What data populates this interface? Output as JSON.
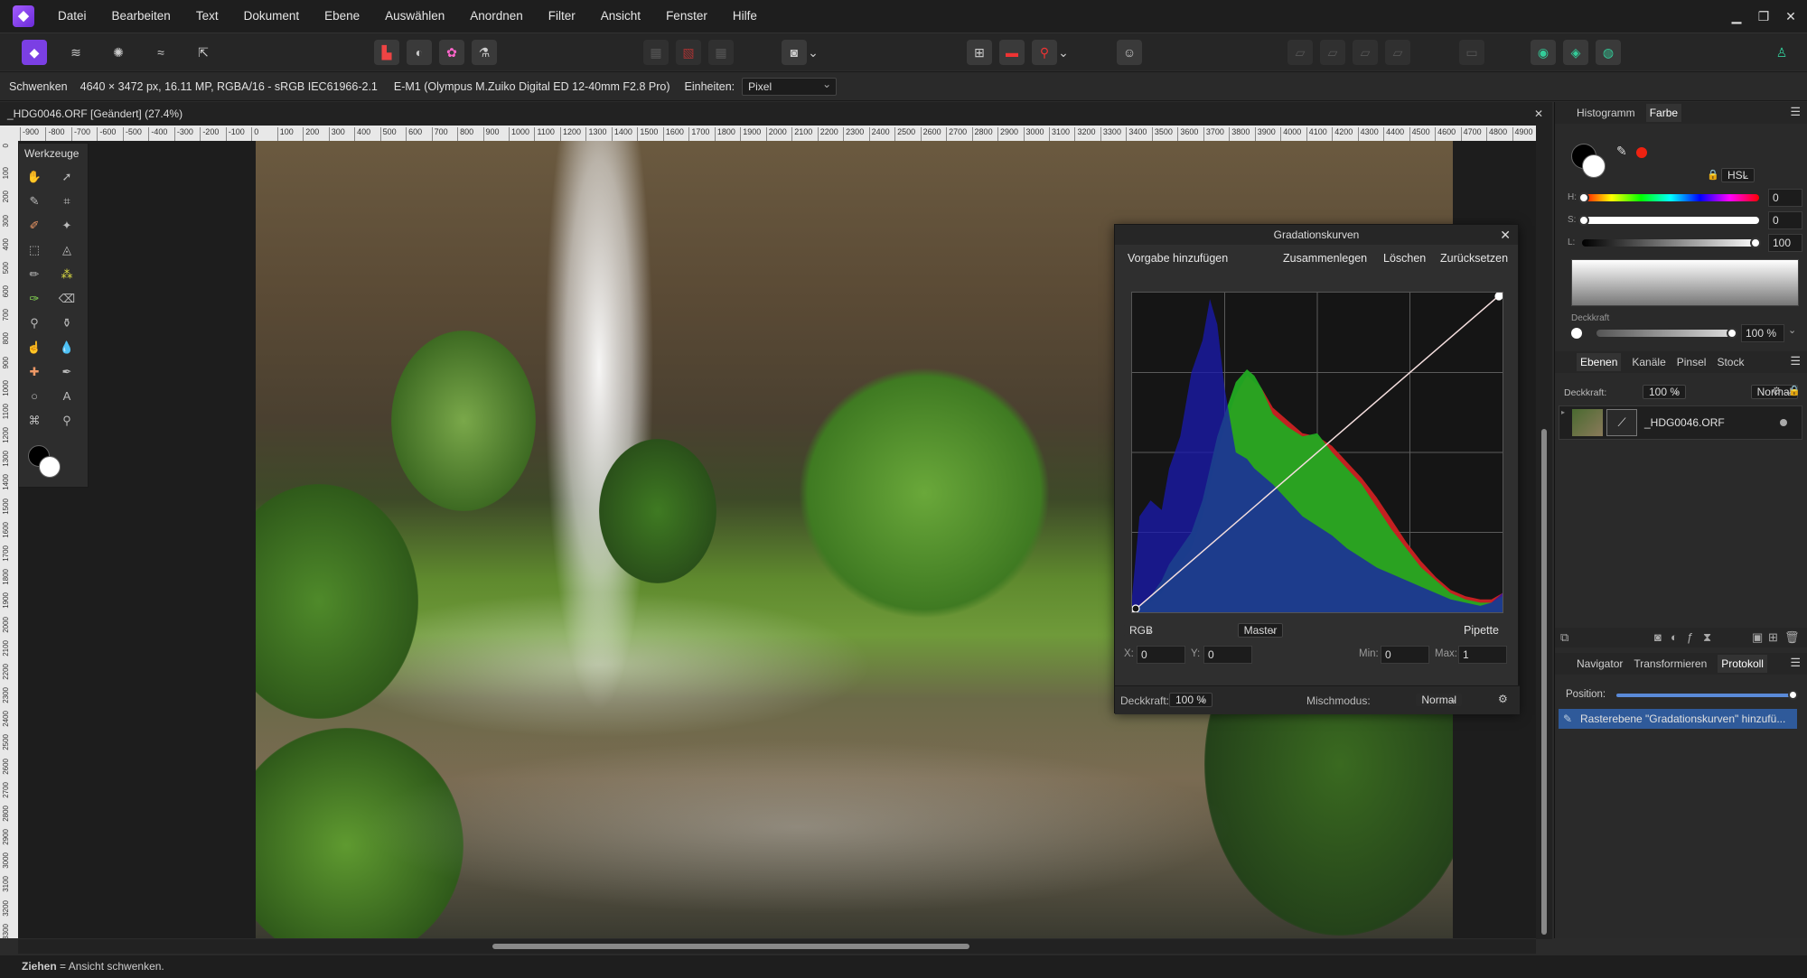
{
  "menubar": {
    "items": [
      "Datei",
      "Bearbeiten",
      "Text",
      "Dokument",
      "Ebene",
      "Auswählen",
      "Anordnen",
      "Filter",
      "Ansicht",
      "Fenster",
      "Hilfe"
    ]
  },
  "contextbar": {
    "tool": "Schwenken",
    "image_info": "4640 × 3472 px, 16.11 MP, RGBA/16 - sRGB IEC61966-2.1",
    "camera": "E-M1 (Olympus M.Zuiko Digital ED 12-40mm F2.8 Pro)",
    "units_label": "Einheiten:",
    "units_value": "Pixel"
  },
  "document": {
    "tab_title": "_HDG0046.ORF [Geändert] (27.4%)"
  },
  "ruler": {
    "h_labels": [
      "-900",
      "-800",
      "-700",
      "-600",
      "-500",
      "-400",
      "-300",
      "-200",
      "-100",
      "0",
      "100",
      "200",
      "300",
      "400",
      "500",
      "600",
      "700",
      "800",
      "900",
      "1000",
      "1100",
      "1200",
      "1300",
      "1400",
      "1500",
      "1600",
      "1700",
      "1800",
      "1900",
      "2000",
      "2100",
      "2200",
      "2300",
      "2400",
      "2500",
      "2600",
      "2700",
      "2800",
      "2900",
      "3000",
      "3100",
      "3200",
      "3300",
      "3400",
      "3500",
      "3600",
      "3700",
      "3800",
      "3900",
      "4000",
      "4100",
      "4200",
      "4300",
      "4400",
      "4500",
      "4600",
      "4700",
      "4800",
      "4900"
    ],
    "v_labels": [
      "0",
      "100",
      "200",
      "300",
      "400",
      "500",
      "600",
      "700",
      "800",
      "900",
      "1000",
      "1100",
      "1200",
      "1300",
      "1400",
      "1500",
      "1600",
      "1700",
      "1800",
      "1900",
      "2000",
      "2100",
      "2200",
      "2300",
      "2400",
      "2500",
      "2600",
      "2700",
      "2800",
      "2900",
      "3000",
      "3100",
      "3200",
      "3300"
    ]
  },
  "tools": {
    "title": "Werkzeuge"
  },
  "curves": {
    "title": "Gradationskurven",
    "add_preset": "Vorgabe hinzufügen",
    "merge": "Zusammenlegen",
    "delete": "Löschen",
    "reset": "Zurücksetzen",
    "channel": "RGB",
    "mode": "Master",
    "picker": "Pipette",
    "x_label": "X:",
    "x_value": "0",
    "y_label": "Y:",
    "y_value": "0",
    "min_label": "Min:",
    "min_value": "0",
    "max_label": "Max:",
    "max_value": "1",
    "opacity_label": "Deckkraft:",
    "opacity_value": "100 %",
    "blend_label": "Mischmodus:",
    "blend_value": "Normal"
  },
  "color_panel": {
    "tab_histogram": "Histogramm",
    "tab_color": "Farbe",
    "model": "HSL",
    "h_label": "H:",
    "h_value": "0",
    "s_label": "S:",
    "s_value": "0",
    "l_label": "L:",
    "l_value": "100",
    "opacity_label": "Deckkraft",
    "opacity_value": "100 %"
  },
  "layers_panel": {
    "tabs": [
      "Ebenen",
      "Kanäle",
      "Pinsel",
      "Stock"
    ],
    "opacity_label": "Deckkraft:",
    "opacity_value": "100 %",
    "blend_value": "Normal",
    "layer_name": "_HDG0046.ORF"
  },
  "history_panel": {
    "tabs": [
      "Navigator",
      "Transformieren",
      "Protokoll"
    ],
    "position_label": "Position:",
    "entry": "Rasterebene \"Gradationskurven\" hinzufü..."
  },
  "status": {
    "action": "Ziehen",
    "hint": "= Ansicht schwenken."
  },
  "chart_data": {
    "type": "area",
    "title": "",
    "xlim": [
      0,
      1
    ],
    "ylim": [
      0,
      1
    ],
    "grid": true,
    "x": [
      0,
      0.02,
      0.05,
      0.08,
      0.1,
      0.13,
      0.16,
      0.19,
      0.21,
      0.23,
      0.25,
      0.28,
      0.31,
      0.33,
      0.35,
      0.38,
      0.42,
      0.46,
      0.5,
      0.54,
      0.58,
      0.62,
      0.66,
      0.7,
      0.74,
      0.78,
      0.82,
      0.86,
      0.9,
      0.94,
      0.97,
      1.0
    ],
    "series": [
      {
        "name": "",
        "color": "#1a1ab0",
        "values": [
          0.05,
          0.3,
          0.35,
          0.32,
          0.45,
          0.55,
          0.75,
          0.85,
          0.98,
          0.9,
          0.7,
          0.5,
          0.48,
          0.45,
          0.43,
          0.4,
          0.35,
          0.3,
          0.27,
          0.24,
          0.2,
          0.17,
          0.14,
          0.12,
          0.1,
          0.08,
          0.06,
          0.04,
          0.03,
          0.02,
          0.03,
          0.06
        ]
      },
      {
        "name": "",
        "color": "#22aa22",
        "values": [
          0.0,
          0.02,
          0.05,
          0.1,
          0.15,
          0.2,
          0.25,
          0.35,
          0.45,
          0.55,
          0.62,
          0.72,
          0.76,
          0.74,
          0.7,
          0.62,
          0.58,
          0.55,
          0.56,
          0.5,
          0.45,
          0.4,
          0.33,
          0.26,
          0.2,
          0.14,
          0.1,
          0.06,
          0.04,
          0.03,
          0.03,
          0.05
        ]
      },
      {
        "name": "",
        "color": "#cc2222",
        "values": [
          0.0,
          0.01,
          0.03,
          0.06,
          0.1,
          0.15,
          0.2,
          0.3,
          0.4,
          0.5,
          0.58,
          0.68,
          0.74,
          0.72,
          0.7,
          0.64,
          0.6,
          0.56,
          0.55,
          0.52,
          0.47,
          0.42,
          0.36,
          0.29,
          0.22,
          0.16,
          0.11,
          0.07,
          0.05,
          0.04,
          0.04,
          0.06
        ]
      }
    ],
    "curve": [
      [
        0,
        0
      ],
      [
        1,
        1
      ]
    ]
  }
}
